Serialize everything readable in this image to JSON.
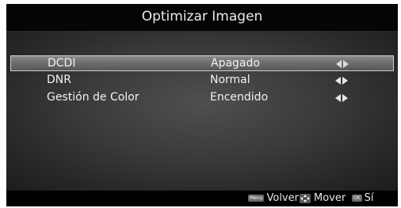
{
  "title": "Optimizar Imagen",
  "menu": {
    "items": [
      {
        "label": "DCDI",
        "value": "Apagado",
        "selected": true
      },
      {
        "label": "DNR",
        "value": "Normal",
        "selected": false
      },
      {
        "label": "Gestión de Color",
        "value": "Encendido",
        "selected": false
      }
    ]
  },
  "footer": {
    "menu_key": "Menu",
    "back_label": "Volver",
    "move_label": "Mover",
    "ok_key": "OK",
    "ok_label": "Sí"
  },
  "colors": {
    "background": "#000000",
    "text": "#f2f2f2",
    "highlight": "#6e6e6e"
  },
  "icons": {
    "arrows": "left-right-arrows-icon",
    "move": "dpad-icon"
  }
}
